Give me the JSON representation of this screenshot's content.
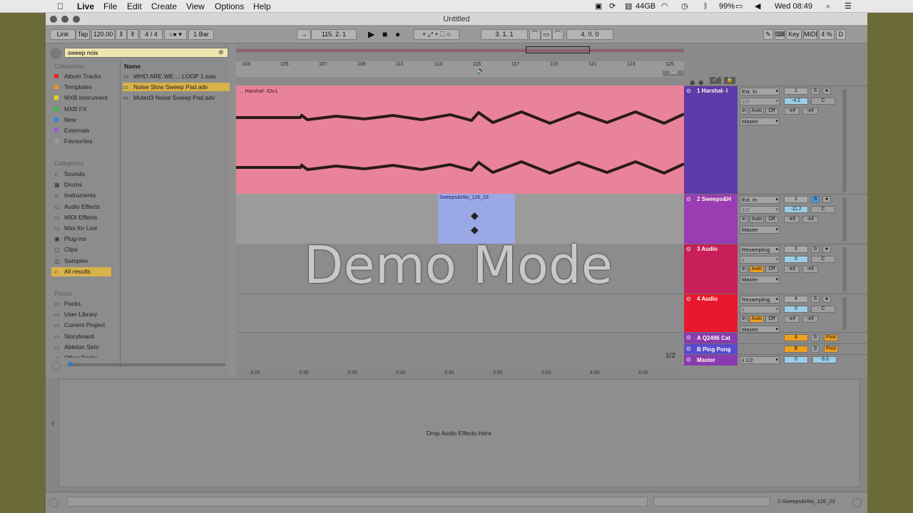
{
  "menubar": {
    "apple_icon": "apple-icon",
    "items": [
      "Live",
      "File",
      "Edit",
      "Create",
      "View",
      "Options",
      "Help"
    ],
    "memory": "44GB",
    "battery": "99%",
    "clock": "Wed 08:49"
  },
  "window": {
    "title": "Untitled"
  },
  "transport": {
    "link": "Link",
    "tap": "Tap",
    "tempo": "120.00",
    "time_sig": "4 / 4",
    "quantize": "1 Bar",
    "position": "115.   2.   1",
    "loop_start": "3.   1.   1",
    "loop_length": "4.   0.   0",
    "key": "Key",
    "midi": "MIDI",
    "cpu": "4 %",
    "d": "D"
  },
  "browser": {
    "search_value": "sweep nois",
    "collections_header": "Collections",
    "collections": [
      {
        "label": "Album Tracks",
        "color": "#e0262a"
      },
      {
        "label": "Templates",
        "color": "#f09020"
      },
      {
        "label": "MXB Instrument",
        "color": "#e0d820"
      },
      {
        "label": "MXB FX",
        "color": "#30c040"
      },
      {
        "label": "New",
        "color": "#2a8ae0"
      },
      {
        "label": "Externals",
        "color": "#9a5ad0"
      },
      {
        "label": "Favourites",
        "color": "#9a9a9a"
      }
    ],
    "categories_header": "Categories",
    "categories": [
      "Sounds",
      "Drums",
      "Instruments",
      "Audio Effects",
      "MIDI Effects",
      "Max for Live",
      "Plug-ins",
      "Clips",
      "Samples",
      "All results"
    ],
    "places_header": "Places",
    "places": [
      "Packs",
      "User Library",
      "Current Project",
      "Storyboard",
      "Ableton Sets",
      "Other Packs"
    ],
    "name_header": "Name",
    "files": [
      "WHO ARE WE ... LOOP 1.wav",
      "Noise Slow Sweep Pad.adv",
      "Muted3 Noise Sweep Pad.adv"
    ]
  },
  "arrangement": {
    "bar_markers": [
      "103",
      "105",
      "107",
      "109",
      "111",
      "113",
      "115",
      "117",
      "119",
      "121",
      "123",
      "125"
    ],
    "time_markers": [
      "3:25",
      "3:30",
      "3:35",
      "3:40",
      "3:45",
      "3:50",
      "3:55",
      "4:00",
      "4:05"
    ],
    "clip1_label": "... Harshal- IDv1",
    "clip2_label": "Sweeps&Hits_126_23",
    "overlay": "Demo Mode",
    "page": "1/2",
    "set_label": "Set"
  },
  "tracks": [
    {
      "name": "1 Harshal- I",
      "color": "#5e3aa8",
      "input": "Ext. In",
      "sub": "1/2",
      "out": "Master",
      "num": "1",
      "vol": "-4.2",
      "pan": "C",
      "inf1": "-inf",
      "inf2": "-inf"
    },
    {
      "name": "2 Sweeps&H",
      "color": "#9a3cb2",
      "input": "Ext. In",
      "sub": "1/2",
      "out": "Master",
      "num": "2",
      "vol": "-11.2",
      "pan": "C",
      "inf1": "-inf",
      "inf2": "-inf"
    },
    {
      "name": "3 Audio",
      "color": "#c81e5a",
      "input": "Resampling",
      "sub": "ii",
      "out": "Master",
      "num": "3",
      "vol": "0",
      "pan": "C",
      "inf1": "-inf",
      "inf2": "-inf"
    },
    {
      "name": "4 Audio",
      "color": "#e8182e",
      "input": "Resampling",
      "sub": "ii",
      "out": "Master",
      "num": "4",
      "vol": "0",
      "pan": "C",
      "inf1": "-inf",
      "inf2": "-inf"
    }
  ],
  "returns": [
    {
      "name": "A Q2496 Cat",
      "color": "#8a3ab0",
      "letter": "A",
      "post": "Post"
    },
    {
      "name": "B Ping Pong",
      "color": "#5a4ad0",
      "letter": "B",
      "post": "Post"
    },
    {
      "name": "Master",
      "color": "#8a3ab0",
      "sub": "ii 1/2",
      "num": "0",
      "vol": "-9.6"
    }
  ],
  "monitor": {
    "in": "In",
    "auto": "Auto",
    "off": "Off"
  },
  "mixer_buttons": {
    "s": "S"
  },
  "device_view": {
    "drop_text": "Drop Audio Effects Here"
  },
  "status": {
    "selected_clip": "2-Sweeps&Hits_126_23"
  }
}
